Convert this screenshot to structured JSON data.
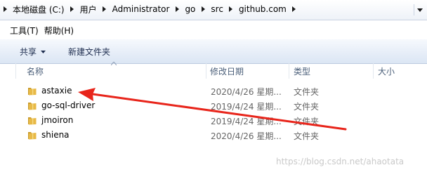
{
  "address_bar": {
    "crumbs": [
      "本地磁盘 (C:)",
      "用户",
      "Administrator",
      "go",
      "src",
      "github.com"
    ]
  },
  "menu": {
    "tools": "工具(T)",
    "help": "帮助(H)"
  },
  "command_bar": {
    "share": "共享",
    "new_folder": "新建文件夹"
  },
  "columns": {
    "name": "名称",
    "modified": "修改日期",
    "type": "类型",
    "size": "大小"
  },
  "files": [
    {
      "name": "astaxie",
      "modified": "2020/4/26 星期...",
      "type": "文件夹"
    },
    {
      "name": "go-sql-driver",
      "modified": "2019/4/24 星期...",
      "type": "文件夹"
    },
    {
      "name": "jmoiron",
      "modified": "2019/4/24 星期...",
      "type": "文件夹"
    },
    {
      "name": "shiena",
      "modified": "2020/4/26 星期...",
      "type": "文件夹"
    }
  ],
  "watermark": "https://blog.csdn.net/ahaotata",
  "colors": {
    "annotation_arrow": "#e8251b",
    "folder": "#e7b947"
  }
}
